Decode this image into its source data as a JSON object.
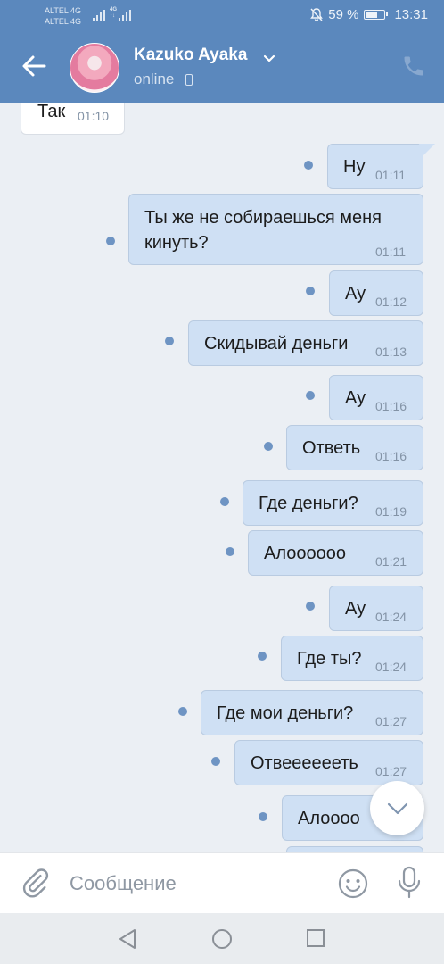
{
  "status_bar": {
    "carrier_1": "ALTEL 4G",
    "carrier_2": "ALTEL 4G",
    "battery_percent": "59 %",
    "battery_level": 0.59,
    "time": "13:31"
  },
  "header": {
    "contact_name": "Kazuko Ayaka",
    "contact_status": "online"
  },
  "messages": [
    {
      "text": "Так",
      "time": "01:10",
      "direction": "in"
    },
    {
      "text": "Ну",
      "time": "01:11",
      "direction": "out"
    },
    {
      "text": "Ты же не собираешься меня кинуть?",
      "time": "01:11",
      "direction": "out"
    },
    {
      "text": "Ау",
      "time": "01:12",
      "direction": "out"
    },
    {
      "text": "Скидывай деньги",
      "time": "01:13",
      "direction": "out"
    },
    {
      "text": "Ау",
      "time": "01:16",
      "direction": "out"
    },
    {
      "text": "Ответь",
      "time": "01:16",
      "direction": "out"
    },
    {
      "text": "Где деньги?",
      "time": "01:19",
      "direction": "out"
    },
    {
      "text": "Алоооооо",
      "time": "01:21",
      "direction": "out"
    },
    {
      "text": "Ау",
      "time": "01:24",
      "direction": "out"
    },
    {
      "text": "Где ты?",
      "time": "01:24",
      "direction": "out"
    },
    {
      "text": "Где мои деньги?",
      "time": "01:27",
      "direction": "out"
    },
    {
      "text": "Отвееееееть",
      "time": "01:27",
      "direction": "out"
    },
    {
      "text": "Алоооо",
      "time": "",
      "direction": "out"
    }
  ],
  "composer": {
    "placeholder": "Сообщение"
  },
  "colors": {
    "header_bg": "#5b88bd",
    "outgoing_bubble": "#cfe0f4",
    "incoming_bubble": "#ffffff",
    "unread_dot": "#6e94c3",
    "chat_bg": "#ebeff4"
  },
  "icons": [
    "back-arrow-icon",
    "chevron-down-icon",
    "phone-icon",
    "mobile-icon",
    "paperclip-icon",
    "emoji-icon",
    "microphone-icon",
    "chevron-down-icon",
    "nav-back-icon",
    "nav-home-icon",
    "nav-recent-icon",
    "mute-icon",
    "battery-icon"
  ]
}
